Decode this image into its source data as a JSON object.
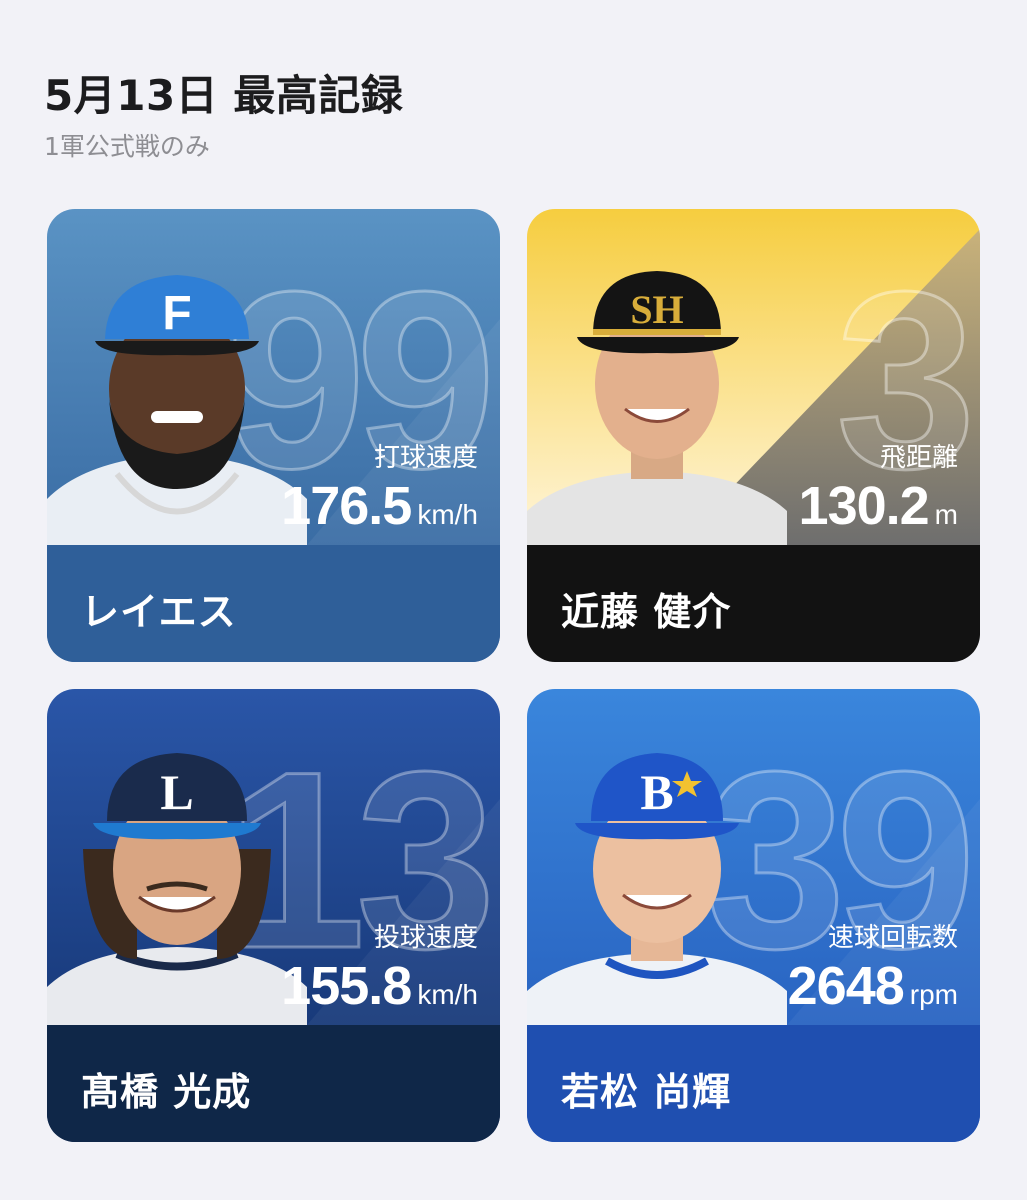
{
  "header": {
    "title": "5月13日 最高記録",
    "subtitle": "1軍公式戦のみ"
  },
  "cards": [
    {
      "jersey_number": "99",
      "stat_label": "打球速度",
      "stat_value": "176.5",
      "stat_unit": "km/h",
      "player_name": "レイエス",
      "cap_logo": "F",
      "colors": {
        "primary": "#3a6ea8",
        "accent": "#2f80d8"
      }
    },
    {
      "jersey_number": "3",
      "stat_label": "飛距離",
      "stat_value": "130.2",
      "stat_unit": "m",
      "player_name": "近藤 健介",
      "cap_logo": "SH",
      "colors": {
        "primary": "#f5cd45",
        "accent": "#111111"
      }
    },
    {
      "jersey_number": "13",
      "stat_label": "投球速度",
      "stat_value": "155.8",
      "stat_unit": "km/h",
      "player_name": "髙橋 光成",
      "cap_logo": "L",
      "colors": {
        "primary": "#1d3f85",
        "accent": "#0f2748"
      }
    },
    {
      "jersey_number": "39",
      "stat_label": "速球回転数",
      "stat_value": "2648",
      "stat_unit": "rpm",
      "player_name": "若松 尚輝",
      "cap_logo": "B",
      "colors": {
        "primary": "#2a6fd0",
        "accent": "#1f4fb0"
      }
    }
  ]
}
